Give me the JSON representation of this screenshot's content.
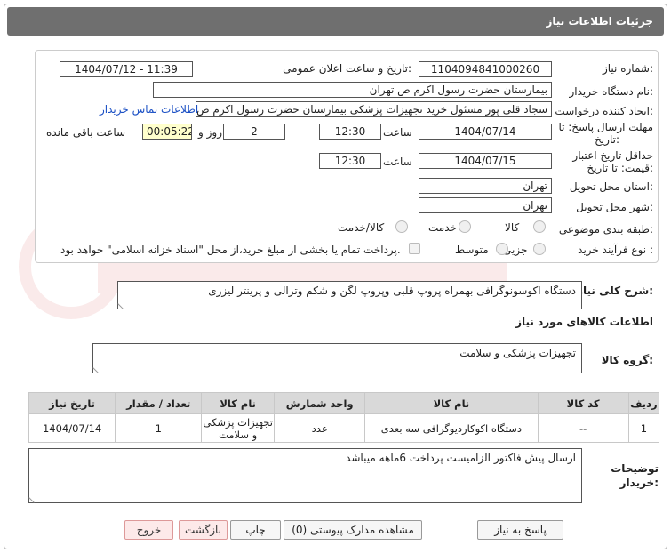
{
  "header": {
    "title": "جزئیات اطلاعات نیاز"
  },
  "form": {
    "need_number_label": "شماره نیاز:",
    "need_number": "1104094841000260",
    "announce_label": "تاریخ و ساعت اعلان عمومی:",
    "announce_value": "1404/07/12 - 11:39",
    "buyer_org_label": "نام دستگاه خریدار:",
    "buyer_org": "بیمارستان حضرت رسول اکرم ص  تهران",
    "creator_label": "ایجاد کننده درخواست:",
    "creator": "سجاد قلی پور مسئول خرید تجهیزات پزشکی  بیمارستان حضرت رسول اکرم ص",
    "contact_link": "اطلاعات تماس خریدار",
    "deadline_label_1": "مهلت ارسال پاسخ: تا",
    "deadline_label_2": "تاریخ:",
    "deadline_date": "1404/07/14",
    "time_label": "ساعت",
    "deadline_time": "12:30",
    "days_value": "2",
    "days_label": "روز و",
    "remaining_value": "00:05:22",
    "remaining_label": "ساعت باقی مانده",
    "validity_label_1": "حداقل تاریخ اعتبار",
    "validity_label_2": "قیمت: تا تاریخ:",
    "validity_date": "1404/07/15",
    "validity_time": "12:30",
    "province_label": "استان محل تحویل:",
    "province": "تهران",
    "city_label": "شهر محل تحویل:",
    "city": "تهران",
    "category_label": "طبقه بندی موضوعی:",
    "category_options": [
      "کالا",
      "خدمت",
      "کالا/خدمت"
    ],
    "process_label": "نوع فرآیند خرید :",
    "process_options": [
      "جزیی",
      "متوسط"
    ],
    "payment_note": "پرداخت تمام یا بخشی از مبلغ خرید،از محل \"اسناد خزانه اسلامی\" خواهد بود."
  },
  "general_desc": {
    "label": "شرح کلی نیاز:",
    "value": "دستگاه اکوسونوگرافی بهمراه پروپ قلبی وپروپ لگن و شکم وترالی و پرینتر لیزری"
  },
  "goods_info_title": "اطلاعات کالاهای مورد نیاز",
  "goods_group": {
    "label": "گروه کالا:",
    "value": "تجهیزات پزشکی و سلامت"
  },
  "table": {
    "headers": [
      "ردیف",
      "کد کالا",
      "نام کالا",
      "واحد شمارش",
      "نام کالا",
      "تعداد / مقدار",
      "تاریخ نیاز"
    ],
    "rows": [
      [
        "1",
        "--",
        "دستگاه اکوکاردیوگرافی سه بعدی",
        "عدد",
        "تجهیزات پزشکی و سلامت",
        "1",
        "1404/07/14"
      ]
    ]
  },
  "buyer_notes": {
    "label_1": "توضیحات",
    "label_2": "خریدار:",
    "value": "ارسال پیش فاکتور الزامیست پرداخت 6ماهه میباشد"
  },
  "buttons": {
    "reply": "پاسخ به نیاز",
    "attachments": "مشاهده مدارک پیوستی (0)",
    "print": "چاپ",
    "back": "بازگشت",
    "exit": "خروج"
  },
  "colors": {
    "header_bg": "#6f6f6f",
    "link": "#1a4fc4",
    "table_header": "#d9d9d9",
    "remaining_bg": "#ffffcc"
  }
}
